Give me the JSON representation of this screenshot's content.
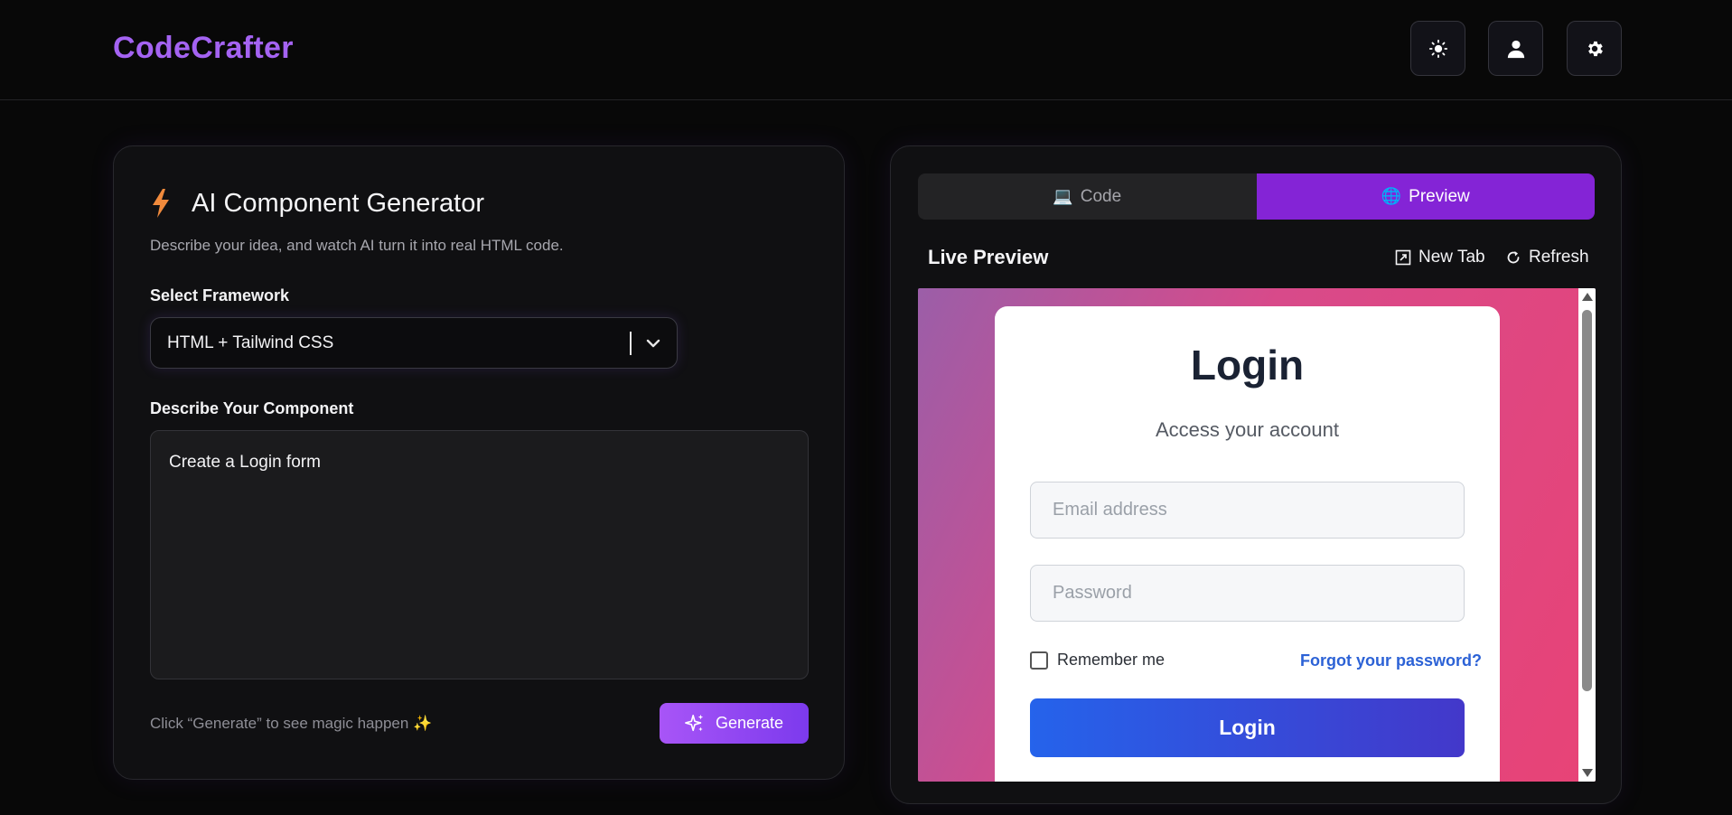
{
  "header": {
    "brand": "CodeCrafter",
    "buttons": [
      {
        "name": "theme-toggle-button",
        "icon": "sun-icon"
      },
      {
        "name": "profile-button",
        "icon": "user-icon"
      },
      {
        "name": "settings-button",
        "icon": "gear-icon"
      }
    ]
  },
  "generator": {
    "title": "AI Component Generator",
    "subtitle": "Describe your idea, and watch AI turn it into real HTML code.",
    "framework_label": "Select Framework",
    "framework_value": "HTML + Tailwind CSS",
    "describe_label": "Describe Your Component",
    "prompt_text": "Create a Login form",
    "hint": "Click “Generate” to see magic happen ✨",
    "generate_label": "Generate"
  },
  "preview_panel": {
    "tabs": [
      {
        "label": "Code",
        "icon": "💻",
        "active": false
      },
      {
        "label": "Preview",
        "icon": "🌐",
        "active": true
      }
    ],
    "live_title": "Live Preview",
    "new_tab_label": "New Tab",
    "refresh_label": "Refresh"
  },
  "login_preview": {
    "heading": "Login",
    "subheading": "Access your account",
    "email_placeholder": "Email address",
    "password_placeholder": "Password",
    "remember_label": "Remember me",
    "forgot_label": "Forgot your password?",
    "button_label": "Login"
  },
  "colors": {
    "brand": "#a463f2",
    "active_tab": "#8424d6",
    "generate_button": "#a855f7",
    "login_button": "#2563eb",
    "forgot_link": "#2c62d6"
  }
}
